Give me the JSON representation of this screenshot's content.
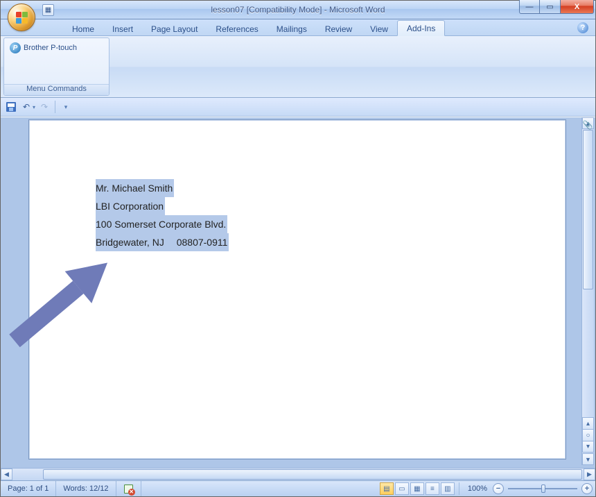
{
  "title": {
    "doc": "lesson07 [Compatibility Mode]",
    "app": "Microsoft Word"
  },
  "tabs": {
    "items": [
      "Home",
      "Insert",
      "Page Layout",
      "References",
      "Mailings",
      "Review",
      "View",
      "Add-Ins"
    ],
    "active_index": 7
  },
  "ribbon": {
    "group_label": "Menu Commands",
    "ptouch_label": "Brother P-touch"
  },
  "document": {
    "lines": [
      "Mr. Michael Smith",
      "LBI Corporation",
      "100 Somerset Corporate Blvd.",
      "Bridgewater, NJ  08807-0911"
    ]
  },
  "status": {
    "page": "Page: 1 of 1",
    "words": "Words: 12/12",
    "zoom": "100%"
  },
  "annotation": {
    "arrow_color": "#6f7bb8"
  }
}
